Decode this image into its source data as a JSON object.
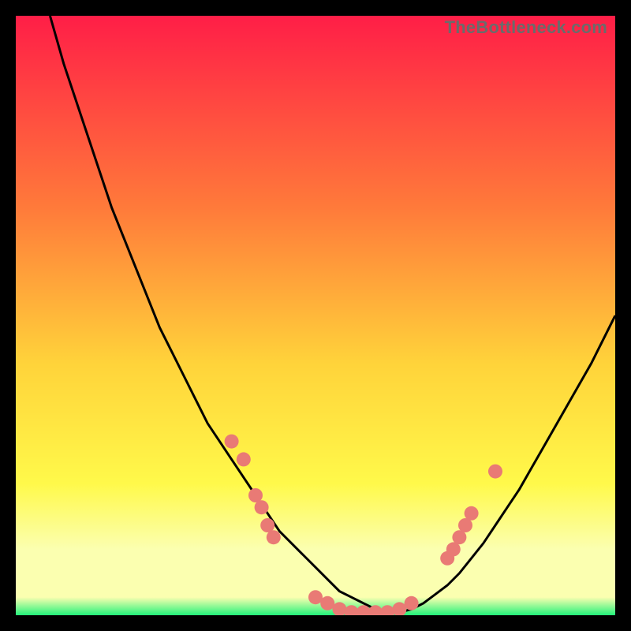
{
  "watermark": "TheBottleneck.com",
  "colors": {
    "black": "#000000",
    "curve": "#000000",
    "dots": "#e97a75",
    "gradient_top": "#ff1e47",
    "gradient_mid1": "#ff7a3a",
    "gradient_mid2": "#ffd33a",
    "gradient_mid3": "#fff94a",
    "gradient_band": "#fbffb0",
    "gradient_bottom": "#23f27a"
  },
  "chart_data": {
    "type": "line",
    "title": "",
    "xlabel": "",
    "ylabel": "",
    "xlim": [
      0,
      100
    ],
    "ylim": [
      0,
      100
    ],
    "grid": false,
    "x": [
      0,
      2,
      4,
      6,
      8,
      10,
      12,
      14,
      16,
      18,
      20,
      22,
      24,
      26,
      28,
      30,
      32,
      34,
      36,
      38,
      40,
      42,
      44,
      46,
      48,
      50,
      52,
      54,
      56,
      58,
      60,
      62,
      64,
      66,
      68,
      70,
      72,
      74,
      76,
      78,
      80,
      82,
      84,
      86,
      88,
      90,
      92,
      94,
      96,
      98,
      100
    ],
    "values": [
      120,
      113,
      106,
      99,
      92,
      86,
      80,
      74,
      68,
      63,
      58,
      53,
      48,
      44,
      40,
      36,
      32,
      29,
      26,
      23,
      20,
      17,
      14,
      12,
      10,
      8,
      6,
      4,
      3,
      2,
      1,
      0.5,
      0.5,
      1,
      2,
      3.5,
      5,
      7,
      9.5,
      12,
      15,
      18,
      21,
      24.5,
      28,
      31.5,
      35,
      38.5,
      42,
      46,
      50
    ],
    "dots": [
      {
        "x": 36,
        "y": 29
      },
      {
        "x": 38,
        "y": 26
      },
      {
        "x": 40,
        "y": 20
      },
      {
        "x": 41,
        "y": 18
      },
      {
        "x": 42,
        "y": 15
      },
      {
        "x": 43,
        "y": 13
      },
      {
        "x": 50,
        "y": 3
      },
      {
        "x": 52,
        "y": 2
      },
      {
        "x": 54,
        "y": 1
      },
      {
        "x": 56,
        "y": 0.5
      },
      {
        "x": 58,
        "y": 0.5
      },
      {
        "x": 60,
        "y": 0.5
      },
      {
        "x": 62,
        "y": 0.5
      },
      {
        "x": 64,
        "y": 1
      },
      {
        "x": 66,
        "y": 2
      },
      {
        "x": 72,
        "y": 9.5
      },
      {
        "x": 73,
        "y": 11
      },
      {
        "x": 74,
        "y": 13
      },
      {
        "x": 75,
        "y": 15
      },
      {
        "x": 76,
        "y": 17
      },
      {
        "x": 80,
        "y": 24
      }
    ]
  }
}
